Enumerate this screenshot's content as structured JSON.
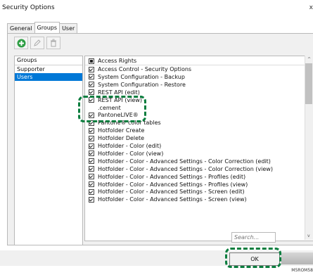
{
  "window": {
    "title": "Security Options",
    "close": "x"
  },
  "tabs": [
    "General",
    "Groups",
    "User"
  ],
  "toolbar": {
    "add_icon": "plus-circle-icon",
    "edit_icon": "pencil-icon",
    "delete_icon": "trash-icon"
  },
  "groups": {
    "header": "Groups",
    "items": [
      "Supporter",
      "Users"
    ],
    "selected": "Users"
  },
  "rights": {
    "header": "Access Rights",
    "items": [
      {
        "label": "Access Control - Security Options",
        "checked": true
      },
      {
        "label": "System Configuration - Backup",
        "checked": true
      },
      {
        "label": "System Configuration - Restore",
        "checked": true
      },
      {
        "label": "REST API (edit)",
        "checked": true
      },
      {
        "label": "REST API (view)",
        "checked": true
      },
      {
        "label": ".cement",
        "checked": false
      },
      {
        "label": "PantoneLIVE®",
        "checked": true
      },
      {
        "label": "Pantone® color tables",
        "checked": true
      },
      {
        "label": "Hotfolder Create",
        "checked": true
      },
      {
        "label": "Hotfolder Delete",
        "checked": true
      },
      {
        "label": "Hotfolder - Color (edit)",
        "checked": true
      },
      {
        "label": "Hotfolder - Color (view)",
        "checked": true
      },
      {
        "label": "Hotfolder - Color - Advanced Settings - Color Correction (edit)",
        "checked": true
      },
      {
        "label": "Hotfolder - Color - Advanced Settings - Color Correction (view)",
        "checked": true
      },
      {
        "label": "Hotfolder - Color - Advanced Settings - Profiles (edit)",
        "checked": true
      },
      {
        "label": "Hotfolder - Color - Advanced Settings - Profiles (view)",
        "checked": true
      },
      {
        "label": "Hotfolder - Color - Advanced Settings - Screen (edit)",
        "checked": true
      },
      {
        "label": "Hotfolder - Color - Advanced Settings - Screen (view)",
        "checked": true
      }
    ]
  },
  "search": {
    "placeholder": "Search..."
  },
  "buttons": {
    "ok": "OK"
  },
  "figure_code": "M5ROM58",
  "colors": {
    "selection": "#0078d7",
    "callout": "#0a7d3e",
    "add_icon": "#2e9e44"
  }
}
